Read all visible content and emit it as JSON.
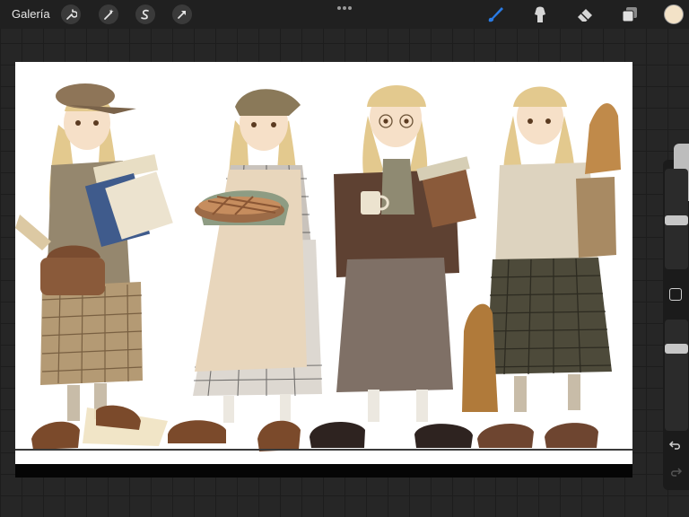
{
  "topbar": {
    "gallery_label": "Galería",
    "left_tools": [
      "wrench-icon",
      "magic-wand-icon",
      "selection-s-icon",
      "transform-arrow-icon"
    ],
    "right_tools": [
      "brush-icon",
      "smudge-icon",
      "eraser-icon",
      "layers-icon"
    ],
    "active_tool": "brush-icon",
    "active_color": "#f3e2c7",
    "accent_color": "#2a7be4"
  },
  "canvas": {
    "artwork": "illustration-four-girls-vintage-clothing"
  },
  "sidebar": {
    "size_slider_level": 0.12,
    "opacity_slider_level": 0.25
  }
}
